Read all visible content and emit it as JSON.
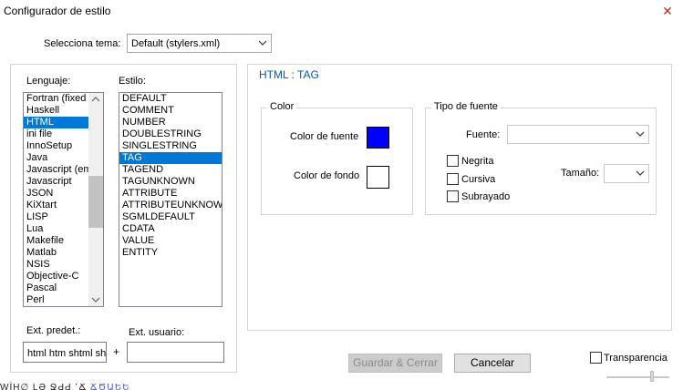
{
  "window": {
    "title": "Configurador de estilo",
    "close_glyph": "✕"
  },
  "theme": {
    "label": "Selecciona tema:",
    "value": "Default (stylers.xml)"
  },
  "languages": {
    "label": "Lenguaje:",
    "items": [
      "Fortran (fixed",
      "Haskell",
      "HTML",
      "ini file",
      "InnoSetup",
      "Java",
      "Javascript (em",
      "Javascript",
      "JSON",
      "KiXtart",
      "LISP",
      "Lua",
      "Makefile",
      "Matlab",
      "NSIS",
      "Objective-C",
      "Pascal",
      "Perl"
    ],
    "selected": "HTML",
    "scroll_position": 0.39
  },
  "styles": {
    "label": "Estilo:",
    "items": [
      "DEFAULT",
      "COMMENT",
      "NUMBER",
      "DOUBLESTRING",
      "SINGLESTRING",
      "TAG",
      "TAGEND",
      "TAGUNKNOWN",
      "ATTRIBUTE",
      "ATTRIBUTEUNKNOWN",
      "SGMLDEFAULT",
      "CDATA",
      "VALUE",
      "ENTITY"
    ],
    "selected": "TAG"
  },
  "ext": {
    "default_label": "Ext. predet.:",
    "default_value": "html htm shtml sh",
    "user_label": "Ext. usuario:",
    "user_value": "",
    "plus": "+"
  },
  "style_header": "HTML : TAG",
  "color": {
    "legend": "Color",
    "fg_label": "Color de fuente",
    "bg_label": "Color de fondo",
    "fg_color": "#0000ff",
    "bg_color": "#ffffff"
  },
  "font": {
    "legend": "Tipo de fuente",
    "font_label": "Fuente:",
    "font_value": "",
    "size_label": "Tamaño:",
    "size_value": "",
    "bold_label": "Negrita",
    "italic_label": "Cursiva",
    "underline_label": "Subrayado",
    "bold_checked": false,
    "italic_checked": false,
    "underline_checked": false
  },
  "buttons": {
    "save": "Guardar & Cerrar",
    "cancel": "Cancelar"
  },
  "transparency": {
    "label": "Transparencia",
    "checked": false
  },
  "bottom_strip": {
    "text_left": "WÏH∅ LƏ ՋԀԀ ՙՃ",
    "text_blue": "ՃԾԱԵԵ"
  },
  "colors": {
    "selection": "#0078d7",
    "header_blue": "#0055cc",
    "disabled_button": "#cccccc"
  }
}
